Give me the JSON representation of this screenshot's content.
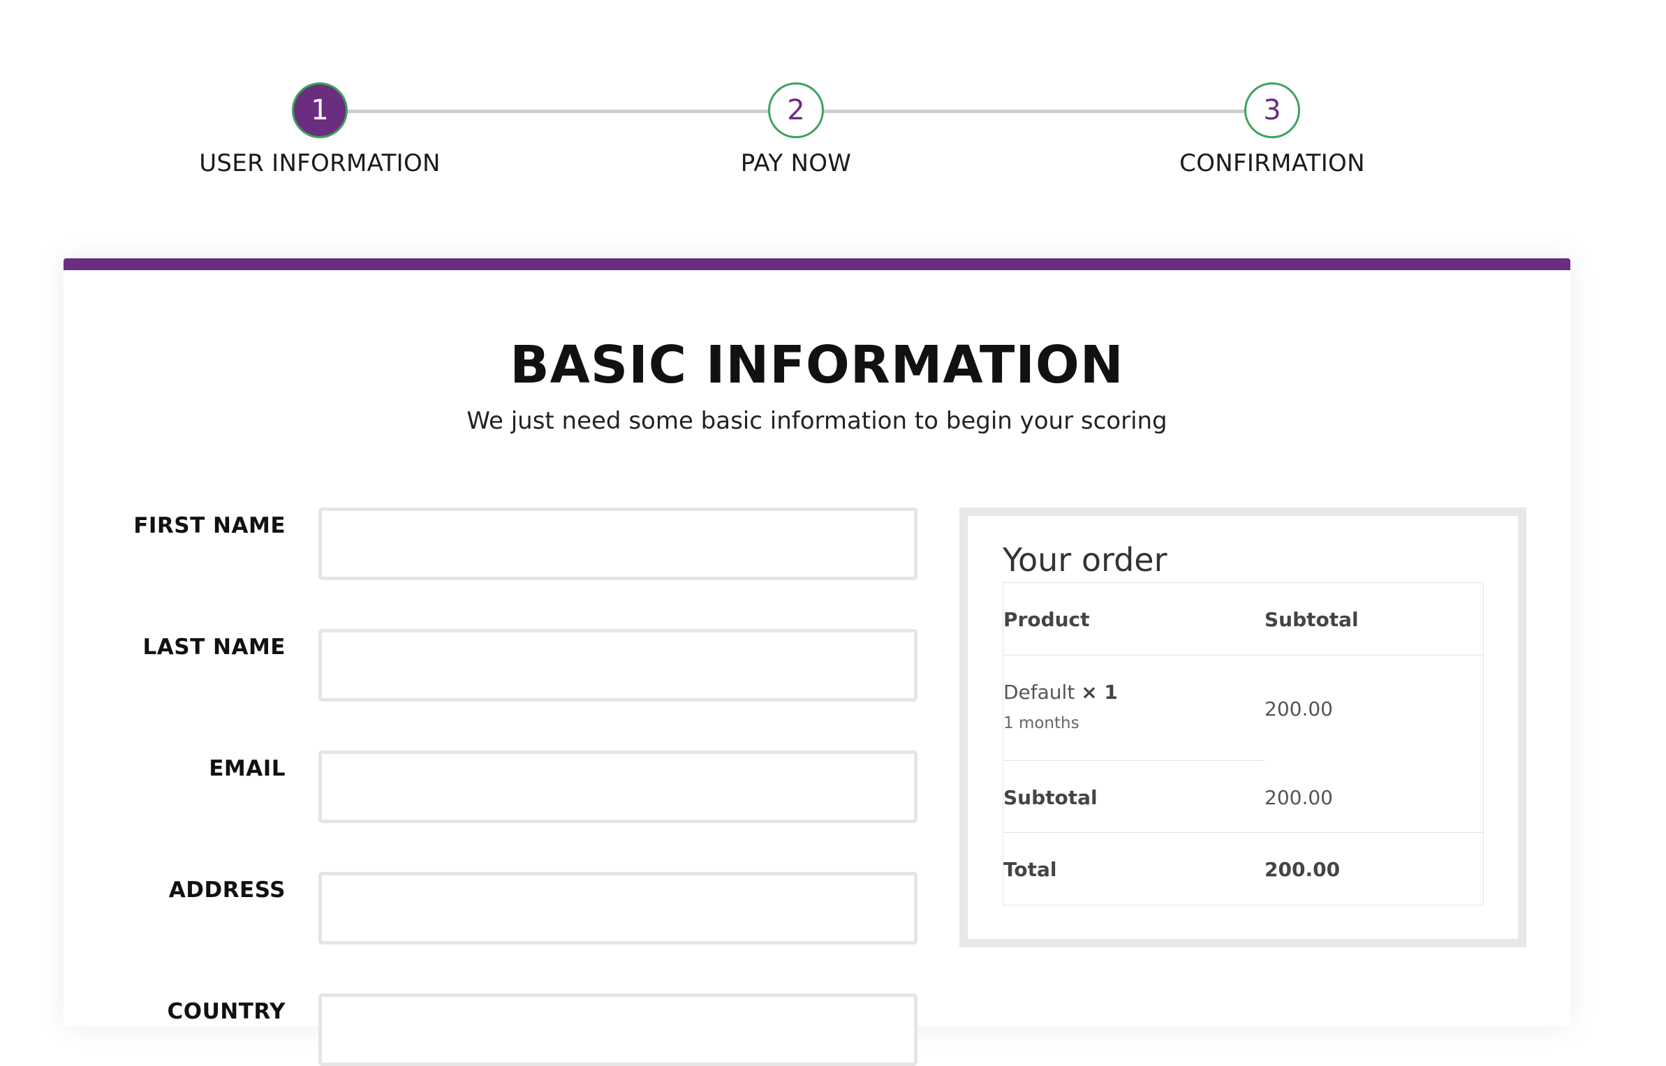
{
  "stepper": {
    "steps": [
      {
        "number": "1",
        "label": "USER INFORMATION"
      },
      {
        "number": "2",
        "label": "PAY NOW"
      },
      {
        "number": "3",
        "label": "CONFIRMATION"
      }
    ]
  },
  "header": {
    "title": "BASIC INFORMATION",
    "subtitle": "We just need some basic information to begin your scoring"
  },
  "form": {
    "fields": [
      {
        "label": "FIRST NAME",
        "value": ""
      },
      {
        "label": "LAST NAME",
        "value": ""
      },
      {
        "label": "EMAIL",
        "value": ""
      },
      {
        "label": "ADDRESS",
        "value": ""
      },
      {
        "label": "COUNTRY",
        "value": ""
      }
    ]
  },
  "order": {
    "title": "Your order",
    "columns": {
      "product": "Product",
      "subtotal": "Subtotal"
    },
    "item": {
      "name": "Default",
      "quantity": "× 1",
      "meta": "1 months",
      "price": "200.00"
    },
    "subtotal": {
      "label": "Subtotal",
      "value": "200.00"
    },
    "total": {
      "label": "Total",
      "value": "200.00"
    }
  },
  "colors": {
    "accent": "#6b2d80",
    "step_border": "#3aa35c"
  }
}
